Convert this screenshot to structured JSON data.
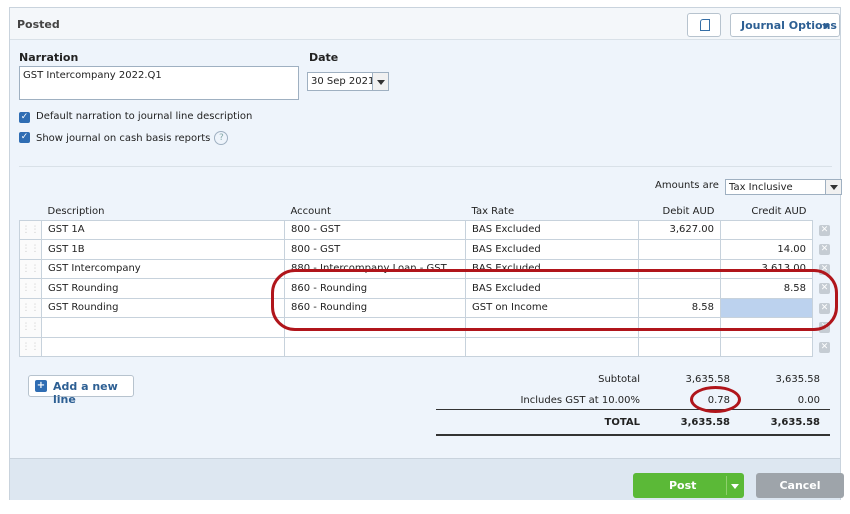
{
  "header": {
    "status": "Posted",
    "journal_options": "Journal Options"
  },
  "form": {
    "narration_label": "Narration",
    "narration_value": "GST Intercompany 2022.Q1",
    "date_label": "Date",
    "date_value": "30 Sep 2021",
    "cb_default_narration": "Default narration to journal line description",
    "cb_cash_basis": "Show journal on cash basis reports"
  },
  "amounts": {
    "label": "Amounts are",
    "value": "Tax Inclusive"
  },
  "table": {
    "headers": [
      "Description",
      "Account",
      "Tax Rate",
      "Debit AUD",
      "Credit AUD"
    ],
    "rows": [
      [
        "GST 1A",
        "800 - GST",
        "BAS Excluded",
        "3,627.00",
        ""
      ],
      [
        "GST 1B",
        "800 - GST",
        "BAS Excluded",
        "",
        "14.00"
      ],
      [
        "GST Intercompany",
        "880 - Intercompany Loan - GST",
        "BAS Excluded",
        "",
        "3,613.00"
      ],
      [
        "GST Rounding",
        "860 - Rounding",
        "BAS Excluded",
        "",
        "8.58"
      ],
      [
        "GST Rounding",
        "860 - Rounding",
        "GST on Income",
        "8.58",
        ""
      ],
      [
        "",
        "",
        "",
        "",
        ""
      ],
      [
        "",
        "",
        "",
        "",
        ""
      ]
    ]
  },
  "add_line": "Add a new line",
  "totals": {
    "subtotal_label": "Subtotal",
    "subtotal_debit": "3,635.58",
    "subtotal_credit": "3,635.58",
    "gst_label": "Includes GST at 10.00%",
    "gst_debit": "0.78",
    "gst_credit": "0.00",
    "total_label": "TOTAL",
    "total_debit": "3,635.58",
    "total_credit": "3,635.58"
  },
  "footer": {
    "post": "Post",
    "cancel": "Cancel"
  },
  "colors": {
    "accent": "#2f6db3",
    "post": "#5bb937",
    "annotation": "#b0151b"
  }
}
